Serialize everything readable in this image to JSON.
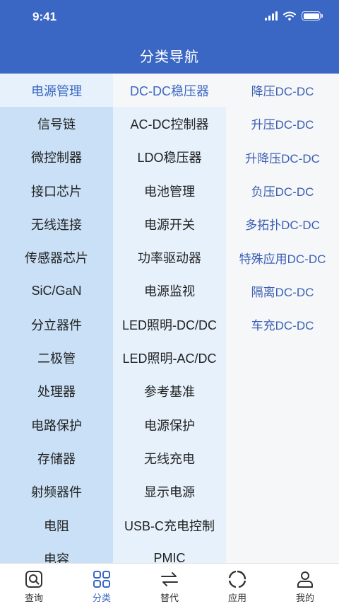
{
  "status": {
    "time": "9:41"
  },
  "header": {
    "title": "分类导航"
  },
  "categories": [
    "电源管理",
    "信号链",
    "微控制器",
    "接口芯片",
    "无线连接",
    "传感器芯片",
    "SiC/GaN",
    "分立器件",
    "二极管",
    "处理器",
    "电路保护",
    "存储器",
    "射频器件",
    "电阻",
    "电容"
  ],
  "subcategories": [
    "DC-DC稳压器",
    "AC-DC控制器",
    "LDO稳压器",
    "电池管理",
    "电源开关",
    "功率驱动器",
    "电源监视",
    "LED照明-DC/DC",
    "LED照明-AC/DC",
    "参考基准",
    "电源保护",
    "无线充电",
    "显示电源",
    "USB-C充电控制",
    "PMIC"
  ],
  "types": [
    "降压DC-DC",
    "升压DC-DC",
    "升降压DC-DC",
    "负压DC-DC",
    "多拓扑DC-DC",
    "特殊应用DC-DC",
    "隔离DC-DC",
    "车充DC-DC"
  ],
  "tabs": [
    {
      "label": "查询",
      "icon": "search-icon"
    },
    {
      "label": "分类",
      "icon": "grid-icon"
    },
    {
      "label": "替代",
      "icon": "swap-icon"
    },
    {
      "label": "应用",
      "icon": "app-ring-icon"
    },
    {
      "label": "我的",
      "icon": "profile-icon"
    }
  ],
  "colors": {
    "primary": "#3a66c4",
    "column1_bg": "#c9e0f6",
    "column2_bg": "#e6f1fb",
    "column3_bg": "#f6f7f9",
    "type_text": "#3b5fb3"
  }
}
